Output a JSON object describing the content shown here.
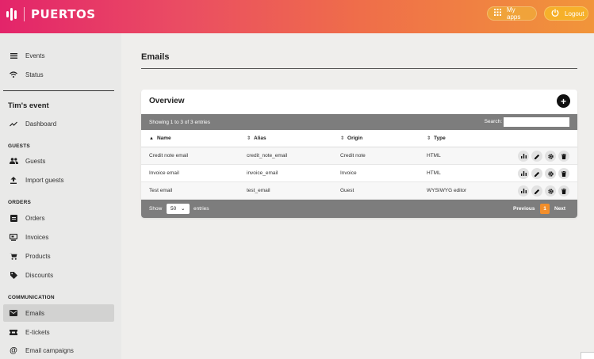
{
  "header": {
    "brand": "PUERTOS",
    "my_apps_label": "My apps",
    "logout_label": "Logout",
    "gradient_start": "#e3246a",
    "gradient_end": "#f1953a"
  },
  "sidebar": {
    "top_items": [
      {
        "label": "Events",
        "icon": "list-icon"
      },
      {
        "label": "Status",
        "icon": "wifi-icon"
      }
    ],
    "event_name": "Tim's event",
    "dashboard_label": "Dashboard",
    "sections": [
      {
        "label": "GUESTS",
        "items": [
          {
            "label": "Guests",
            "icon": "people-icon"
          },
          {
            "label": "Import guests",
            "icon": "upload-icon"
          }
        ]
      },
      {
        "label": "ORDERS",
        "items": [
          {
            "label": "Orders",
            "icon": "order-icon"
          },
          {
            "label": "Invoices",
            "icon": "invoice-icon"
          },
          {
            "label": "Products",
            "icon": "cart-icon"
          },
          {
            "label": "Discounts",
            "icon": "tag-icon"
          }
        ]
      },
      {
        "label": "COMMUNICATION",
        "items": [
          {
            "label": "Emails",
            "icon": "mail-icon",
            "active": true
          },
          {
            "label": "E-tickets",
            "icon": "ticket-icon"
          },
          {
            "label": "Email campaigns",
            "icon": "at-icon"
          }
        ]
      }
    ]
  },
  "main": {
    "page_title": "Emails",
    "card_title": "Overview",
    "add_symbol": "+",
    "table": {
      "info": "Showing 1 to 3 of 3 entries",
      "search_label": "Search:",
      "search_value": "",
      "columns": [
        "Name",
        "Alias",
        "Origin",
        "Type"
      ],
      "rows": [
        {
          "name": "Credit note email",
          "alias": "credit_note_email",
          "origin": "Credit note",
          "type": "HTML"
        },
        {
          "name": "Invoice email",
          "alias": "invoice_email",
          "origin": "Invoice",
          "type": "HTML"
        },
        {
          "name": "Test email",
          "alias": "test_email",
          "origin": "Guest",
          "type": "WYSIWYG editor"
        }
      ],
      "show_label": "Show",
      "page_length": "50",
      "entries_label": "entries",
      "previous_label": "Previous",
      "current_page": "1",
      "next_label": "Next"
    }
  },
  "accent_color": "#f28e2b"
}
